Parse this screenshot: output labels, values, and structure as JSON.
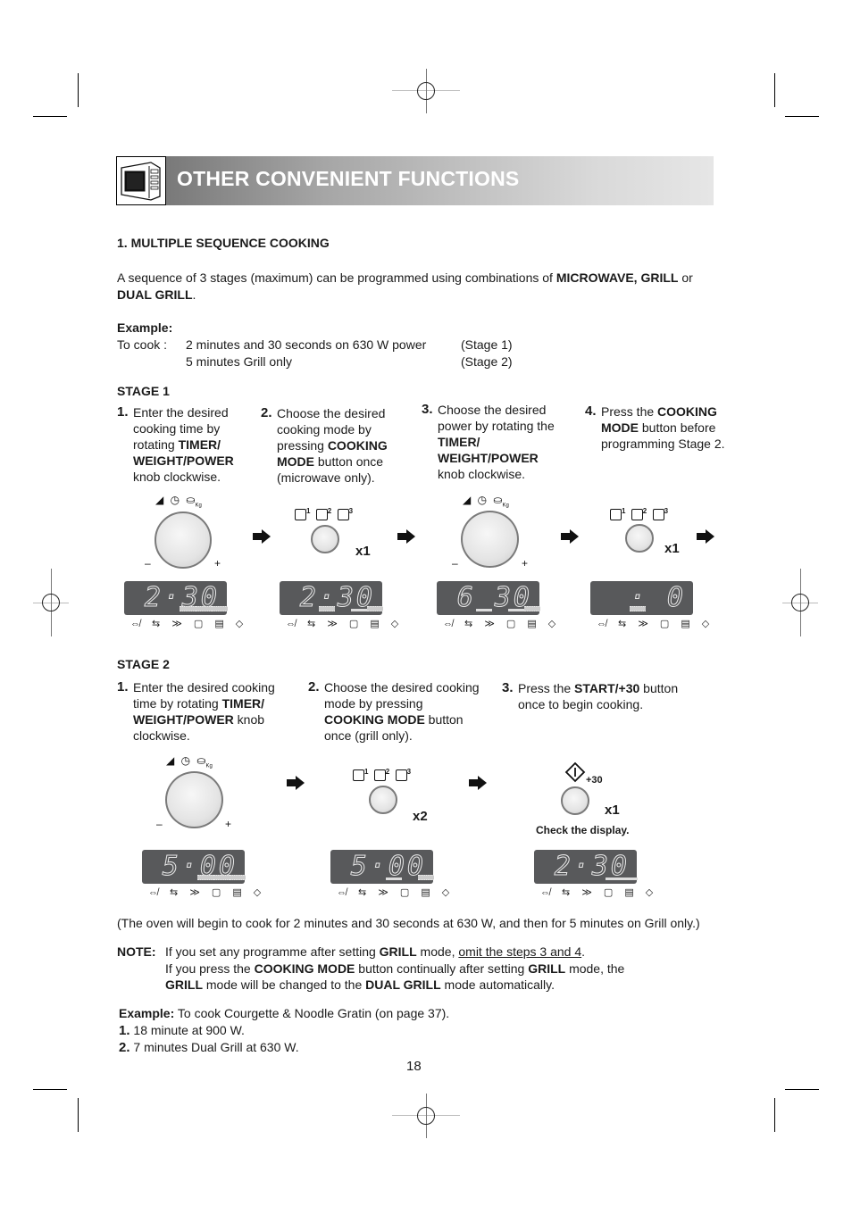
{
  "header": {
    "title": "OTHER CONVENIENT FUNCTIONS",
    "icon": "microwave-icon"
  },
  "section": {
    "title": "1. MULTIPLE SEQUENCE COOKING",
    "intro_pre": "A sequence of 3 stages (maximum) can be programmed using combinations of ",
    "intro_bold1": "MICROWAVE, GRILL",
    "intro_mid": " or",
    "intro_bold2": "DUAL GRILL",
    "intro_end": ".",
    "example_label": "Example:",
    "to_cook_label": "To cook :",
    "example_rows": [
      {
        "text": "2 minutes and 30 seconds on 630 W power",
        "stage": "(Stage 1)"
      },
      {
        "text": "5 minutes Grill only",
        "stage": "(Stage 2)"
      }
    ]
  },
  "stage1": {
    "title": "STAGE 1",
    "steps": [
      {
        "num": "1.",
        "parts": [
          "Enter the desired cooking time by rotating ",
          "TIMER/ WEIGHT/POWER",
          " knob clockwise."
        ]
      },
      {
        "num": "2.",
        "parts": [
          "Choose the desired cooking mode by pressing ",
          "COOKING MODE",
          " button once (microwave only)."
        ]
      },
      {
        "num": "3.",
        "parts": [
          "Choose the desired power by rotating the ",
          "TIMER/ WEIGHT/POWER",
          " knob clockwise."
        ]
      },
      {
        "num": "4.",
        "parts": [
          "Press the ",
          "COOKING MODE",
          " button before programming Stage 2."
        ]
      }
    ],
    "multipliers": [
      "x1",
      "x1"
    ],
    "displays": [
      "2·30",
      "2·30",
      "6 30",
      "· 0"
    ]
  },
  "stage2": {
    "title": "STAGE 2",
    "steps": [
      {
        "num": "1.",
        "parts": [
          "Enter the desired cooking time by rotating ",
          "TIMER/ WEIGHT/POWER",
          " knob clockwise."
        ]
      },
      {
        "num": "2.",
        "parts": [
          "Choose the desired cooking mode by pressing ",
          "COOKING MODE",
          " button once (grill only)."
        ]
      },
      {
        "num": "3.",
        "parts": [
          "Press the ",
          "START/+30",
          " button once to begin cooking."
        ]
      }
    ],
    "multipliers": [
      "x2",
      "x1"
    ],
    "check_display": "Check the display.",
    "start_label": "+30",
    "displays": [
      "5·00",
      "5·00",
      "2·30"
    ]
  },
  "knob_symbols": {
    "minus": "–",
    "plus": "+",
    "kg": "Kg"
  },
  "mode_labels": [
    "1",
    "2",
    "3"
  ],
  "indicator_icons": "⇎ ⇆ ≫ ▢ ▤ ◇",
  "summary": "(The oven will begin to cook for 2 minutes and 30 seconds at 630 W, and then for 5 minutes on Grill only.)",
  "note": {
    "label": "NOTE:",
    "line1_pre": "If you set any programme after setting ",
    "line1_bold": "GRILL",
    "line1_mid": " mode, ",
    "line1_under": "omit the steps 3 and 4",
    "line1_end": ".",
    "line2_pre": "If you press the ",
    "line2_bold1": "COOKING MODE",
    "line2_mid": " button continually after setting ",
    "line2_bold2": "GRILL",
    "line2_end": " mode, the",
    "line3_bold1": "GRILL",
    "line3_mid": " mode will be changed to the ",
    "line3_bold2": "DUAL GRILL",
    "line3_end": " mode automatically."
  },
  "example2": {
    "label": "Example:",
    "text": " To cook Courgette & Noodle Gratin (on page 37).",
    "items": [
      {
        "num": "1.",
        "text": " 18 minute at 900 W."
      },
      {
        "num": "2.",
        "text": " 7 minutes Dual Grill at 630 W."
      }
    ]
  },
  "page_number": "18"
}
